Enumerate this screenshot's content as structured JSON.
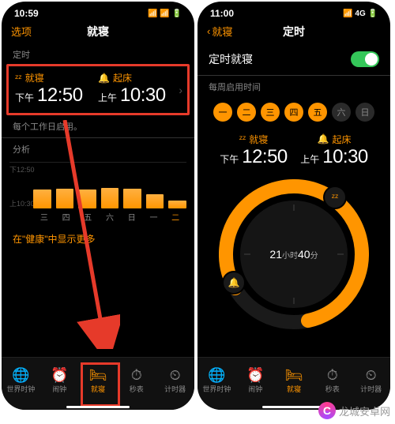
{
  "left": {
    "status_time": "10:59",
    "status_right": "📶 📶 🔋",
    "nav_left": "选项",
    "nav_title": "就寝",
    "sec_timer": "定时",
    "bedtime_label": "就寝",
    "bedtime_prefix": "下午",
    "bedtime_time": "12:50",
    "wake_label": "起床",
    "wake_prefix": "上午",
    "wake_time": "10:30",
    "caption_workdays": "每个工作日启用。",
    "sec_analysis": "分析",
    "y_top": "下12:50",
    "y_bot": "上10:30",
    "xaxis": [
      "三",
      "四",
      "五",
      "六",
      "日",
      "一",
      "二"
    ],
    "footer_link": "在\"健康\"中显示更多",
    "tabs": [
      "世界时钟",
      "闹钟",
      "就寝",
      "秒表",
      "计时器"
    ]
  },
  "right": {
    "status_time": "11:00",
    "status_right": "📶 4G 🔋",
    "nav_back": "就寝",
    "nav_title": "定时",
    "row_scheduled": "定时就寝",
    "sec_weekly": "每周启用时间",
    "days": [
      "一",
      "二",
      "三",
      "四",
      "五",
      "六",
      "日"
    ],
    "days_state": [
      true,
      true,
      true,
      true,
      true,
      false,
      false
    ],
    "bedtime_label": "就寝",
    "bedtime_prefix": "下午",
    "bedtime_time": "12:50",
    "wake_label": "起床",
    "wake_prefix": "上午",
    "wake_time": "10:30",
    "duration_h": "21",
    "duration_h_unit": "小时",
    "duration_m": "40",
    "duration_m_unit": "分",
    "tabs": [
      "世界时钟",
      "闹钟",
      "就寝",
      "秒表",
      "计时器"
    ]
  },
  "watermark": "龙城安卓网",
  "chart_data": {
    "type": "bar",
    "categories": [
      "三",
      "四",
      "五",
      "六",
      "日",
      "一",
      "二"
    ],
    "values": [
      18,
      20,
      19,
      21,
      20,
      14,
      8
    ],
    "ylabels": [
      "下12:50",
      "上10:30"
    ],
    "title": "分析"
  }
}
